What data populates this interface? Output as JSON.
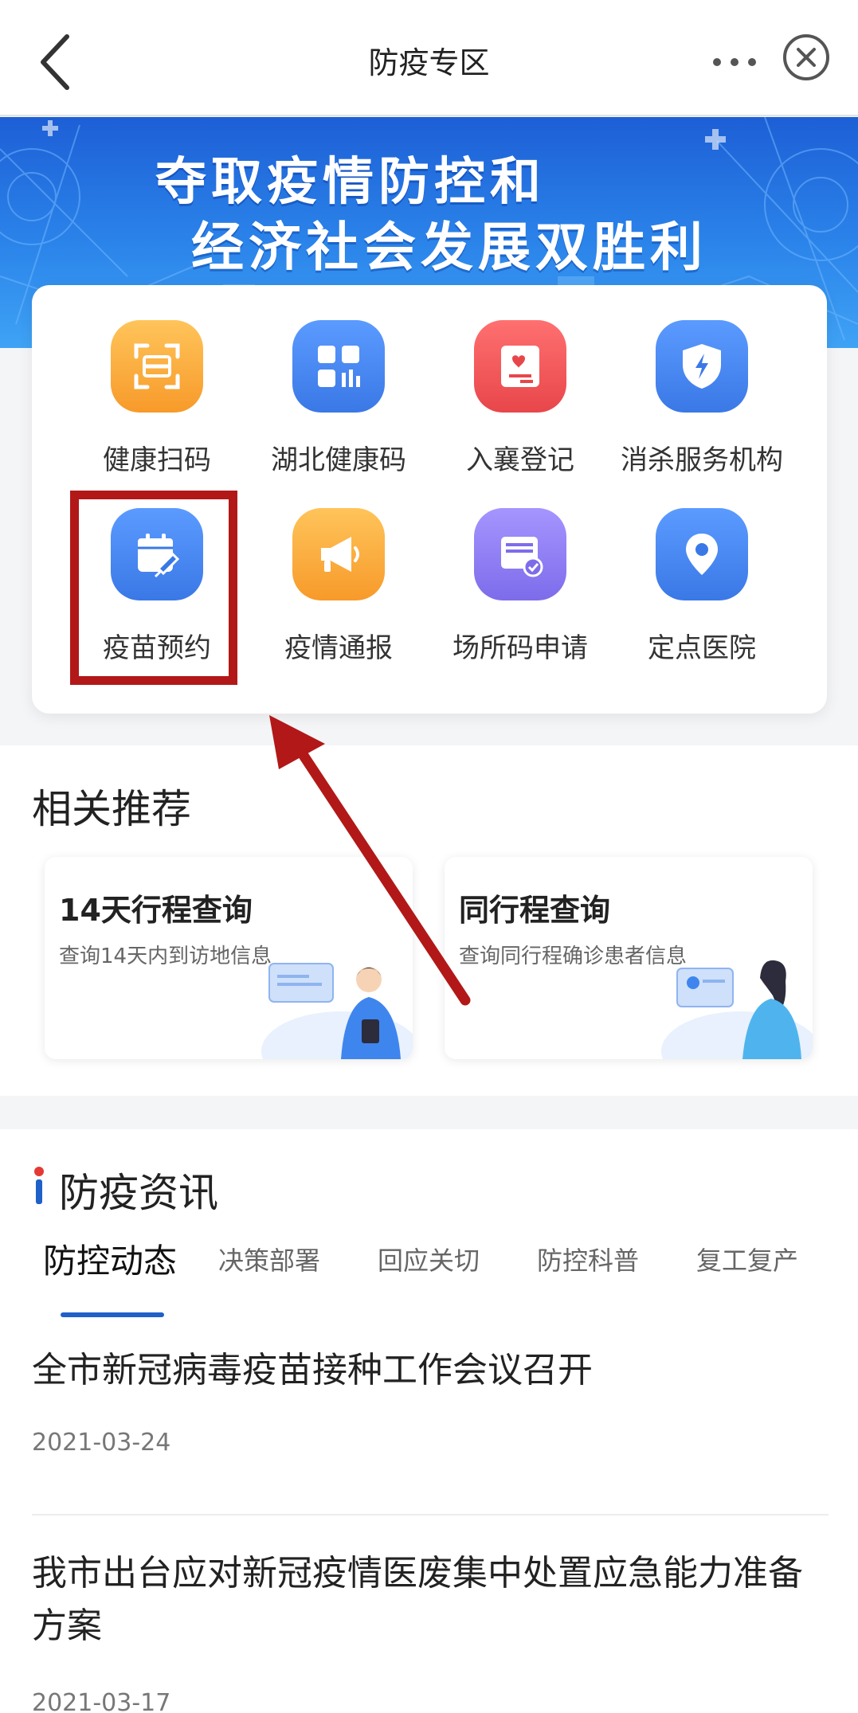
{
  "nav": {
    "title": "防疫专区"
  },
  "banner": {
    "line1": "夺取疫情防控和",
    "line2": "经济社会发展双胜利"
  },
  "services": [
    {
      "label": "健康扫码",
      "icon": "scan-icon",
      "color": "#f9a93b"
    },
    {
      "label": "湖北健康码",
      "icon": "qr-code-icon",
      "color": "#3f85ee"
    },
    {
      "label": "入襄登记",
      "icon": "register-card-icon",
      "color": "#ef5556"
    },
    {
      "label": "消杀服务机构",
      "icon": "shield-bolt-icon",
      "color": "#3f85ee"
    },
    {
      "label": "疫苗预约",
      "icon": "calendar-syringe-icon",
      "color": "#3f85ee"
    },
    {
      "label": "疫情通报",
      "icon": "megaphone-icon",
      "color": "#f9a93b"
    },
    {
      "label": "场所码申请",
      "icon": "document-check-icon",
      "color": "#8b7cf0"
    },
    {
      "label": "定点医院",
      "icon": "location-pin-icon",
      "color": "#3f85ee"
    }
  ],
  "recommend": {
    "title": "相关推荐",
    "cards": [
      {
        "title": "14天行程查询",
        "desc": "查询14天内到访地信息"
      },
      {
        "title": "同行程查询",
        "desc": "查询同行程确诊患者信息"
      }
    ]
  },
  "news": {
    "title": "防疫资讯",
    "tabs": [
      "防控动态",
      "决策部署",
      "回应关切",
      "防控科普",
      "复工复产"
    ],
    "active_tab": "防控动态",
    "items": [
      {
        "title": "全市新冠病毒疫苗接种工作会议召开",
        "date": "2021-03-24"
      },
      {
        "title": "我市出台应对新冠疫情医废集中处置应急能力准备方案",
        "date": "2021-03-17"
      }
    ]
  },
  "colors": {
    "accent": "#1f60c9",
    "annotation": "#b21818"
  }
}
